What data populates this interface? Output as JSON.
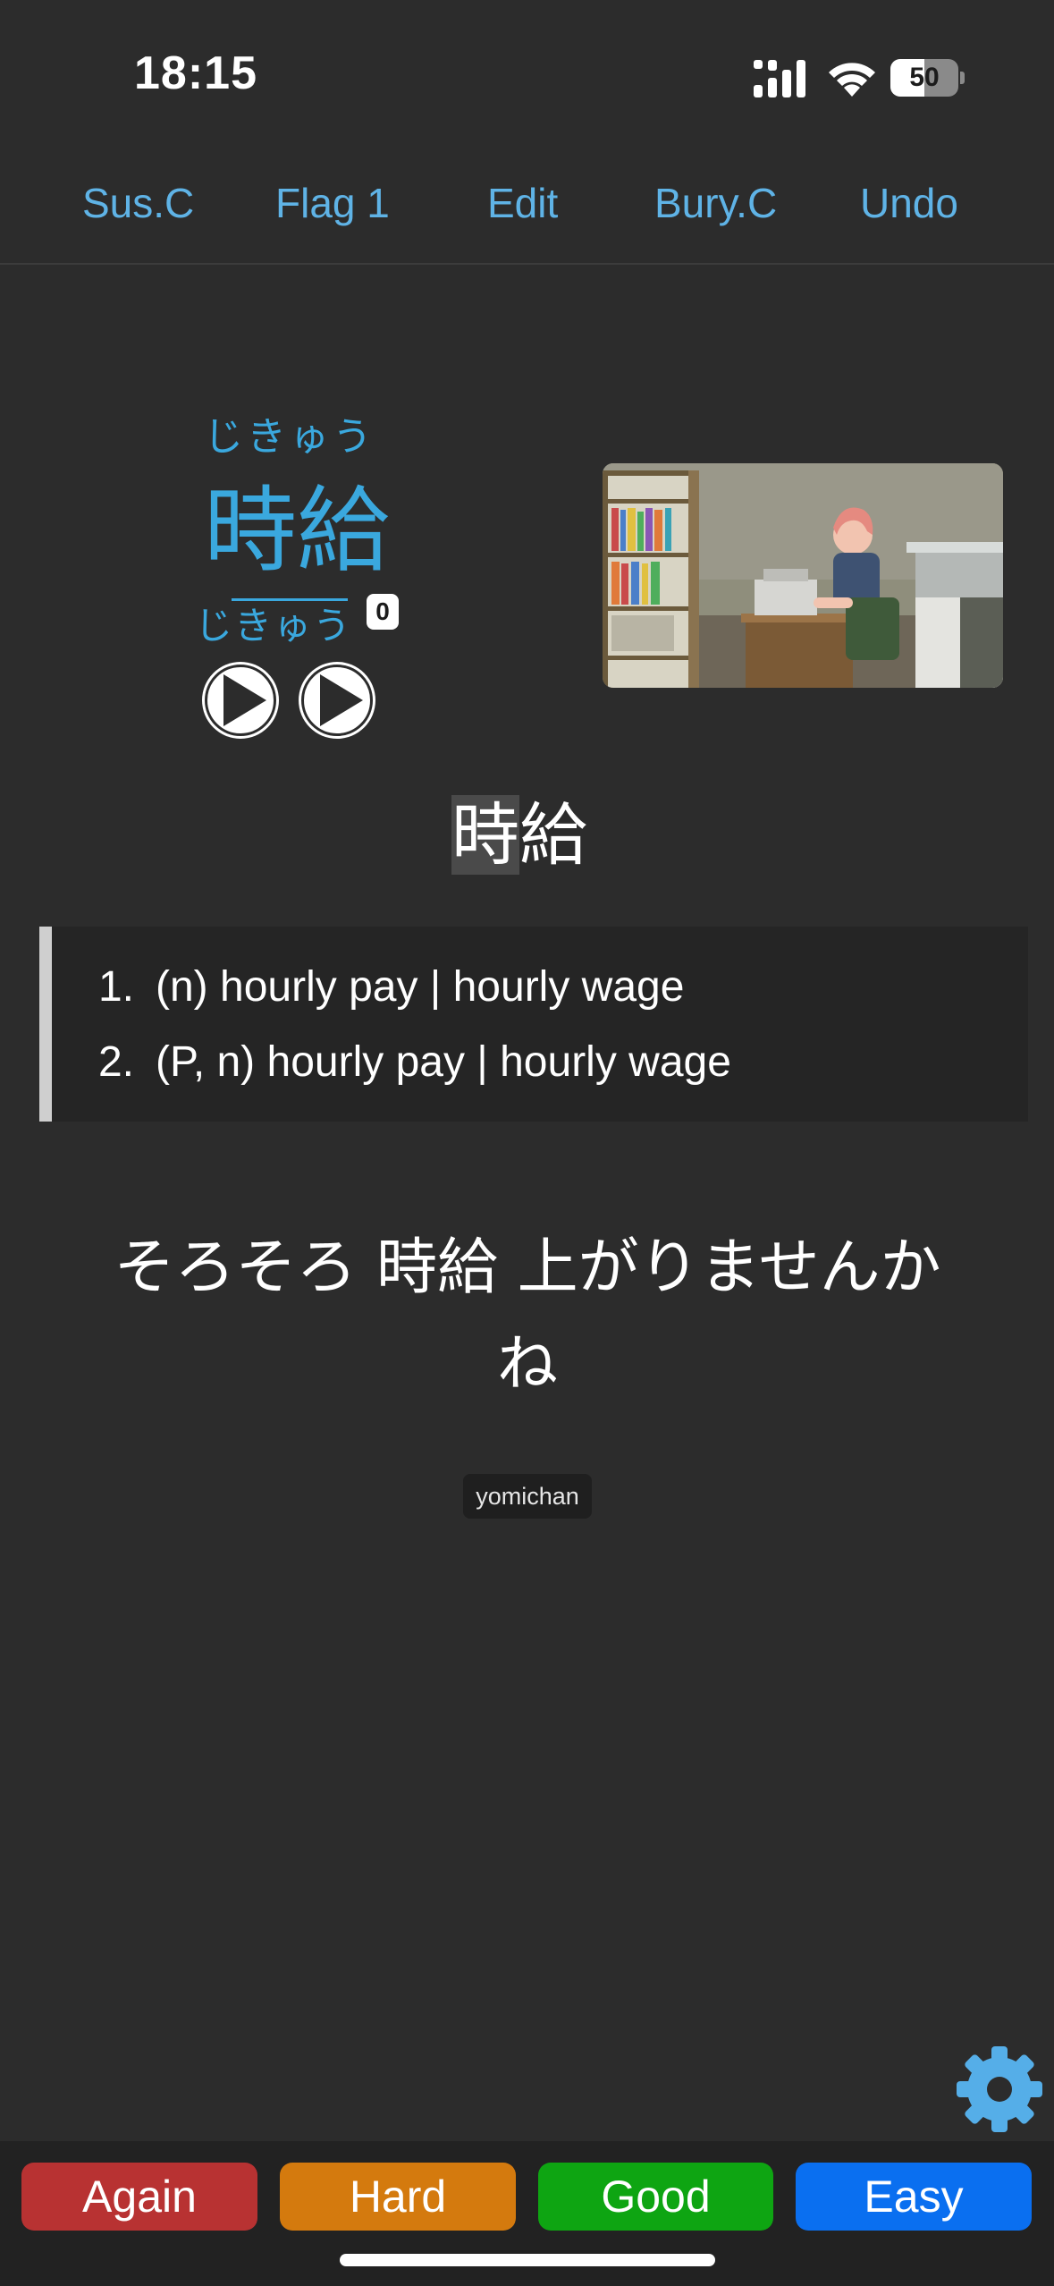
{
  "status_bar": {
    "time": "18:15",
    "battery_level": "50",
    "battery_fraction": 0.5,
    "icons": [
      "signal-icon",
      "wifi-icon",
      "battery-icon"
    ]
  },
  "toolbar": {
    "items": [
      {
        "label": "Sus.C"
      },
      {
        "label": "Flag 1"
      },
      {
        "label": "Edit"
      },
      {
        "label": "Bury.C"
      },
      {
        "label": "Undo"
      }
    ]
  },
  "card": {
    "furigana": "じきゅう",
    "expression": "時給",
    "reading": "じきゅう",
    "pitch_accent": "0",
    "audio_buttons": [
      "play-icon",
      "play-icon"
    ],
    "highlighted_char": "時",
    "rest_chars": "給",
    "glossary": [
      {
        "number": "1.",
        "text": "(n) hourly pay | hourly wage"
      },
      {
        "number": "2.",
        "text": "(P, n) hourly pay | hourly wage"
      }
    ],
    "sentence": "そろそろ 時給 上がりませんか ね",
    "tag": "yomichan"
  },
  "answer_buttons": [
    {
      "label": "Again",
      "color": "#b83232"
    },
    {
      "label": "Hard",
      "color": "#d47a0e"
    },
    {
      "label": "Good",
      "color": "#0ea512"
    },
    {
      "label": "Easy",
      "color": "#0a6ff0"
    }
  ],
  "colors": {
    "background": "#2c2c2c",
    "accent": "#5fb3e6",
    "word_color": "#3aa8de",
    "settings_gear": "#55aee8"
  }
}
